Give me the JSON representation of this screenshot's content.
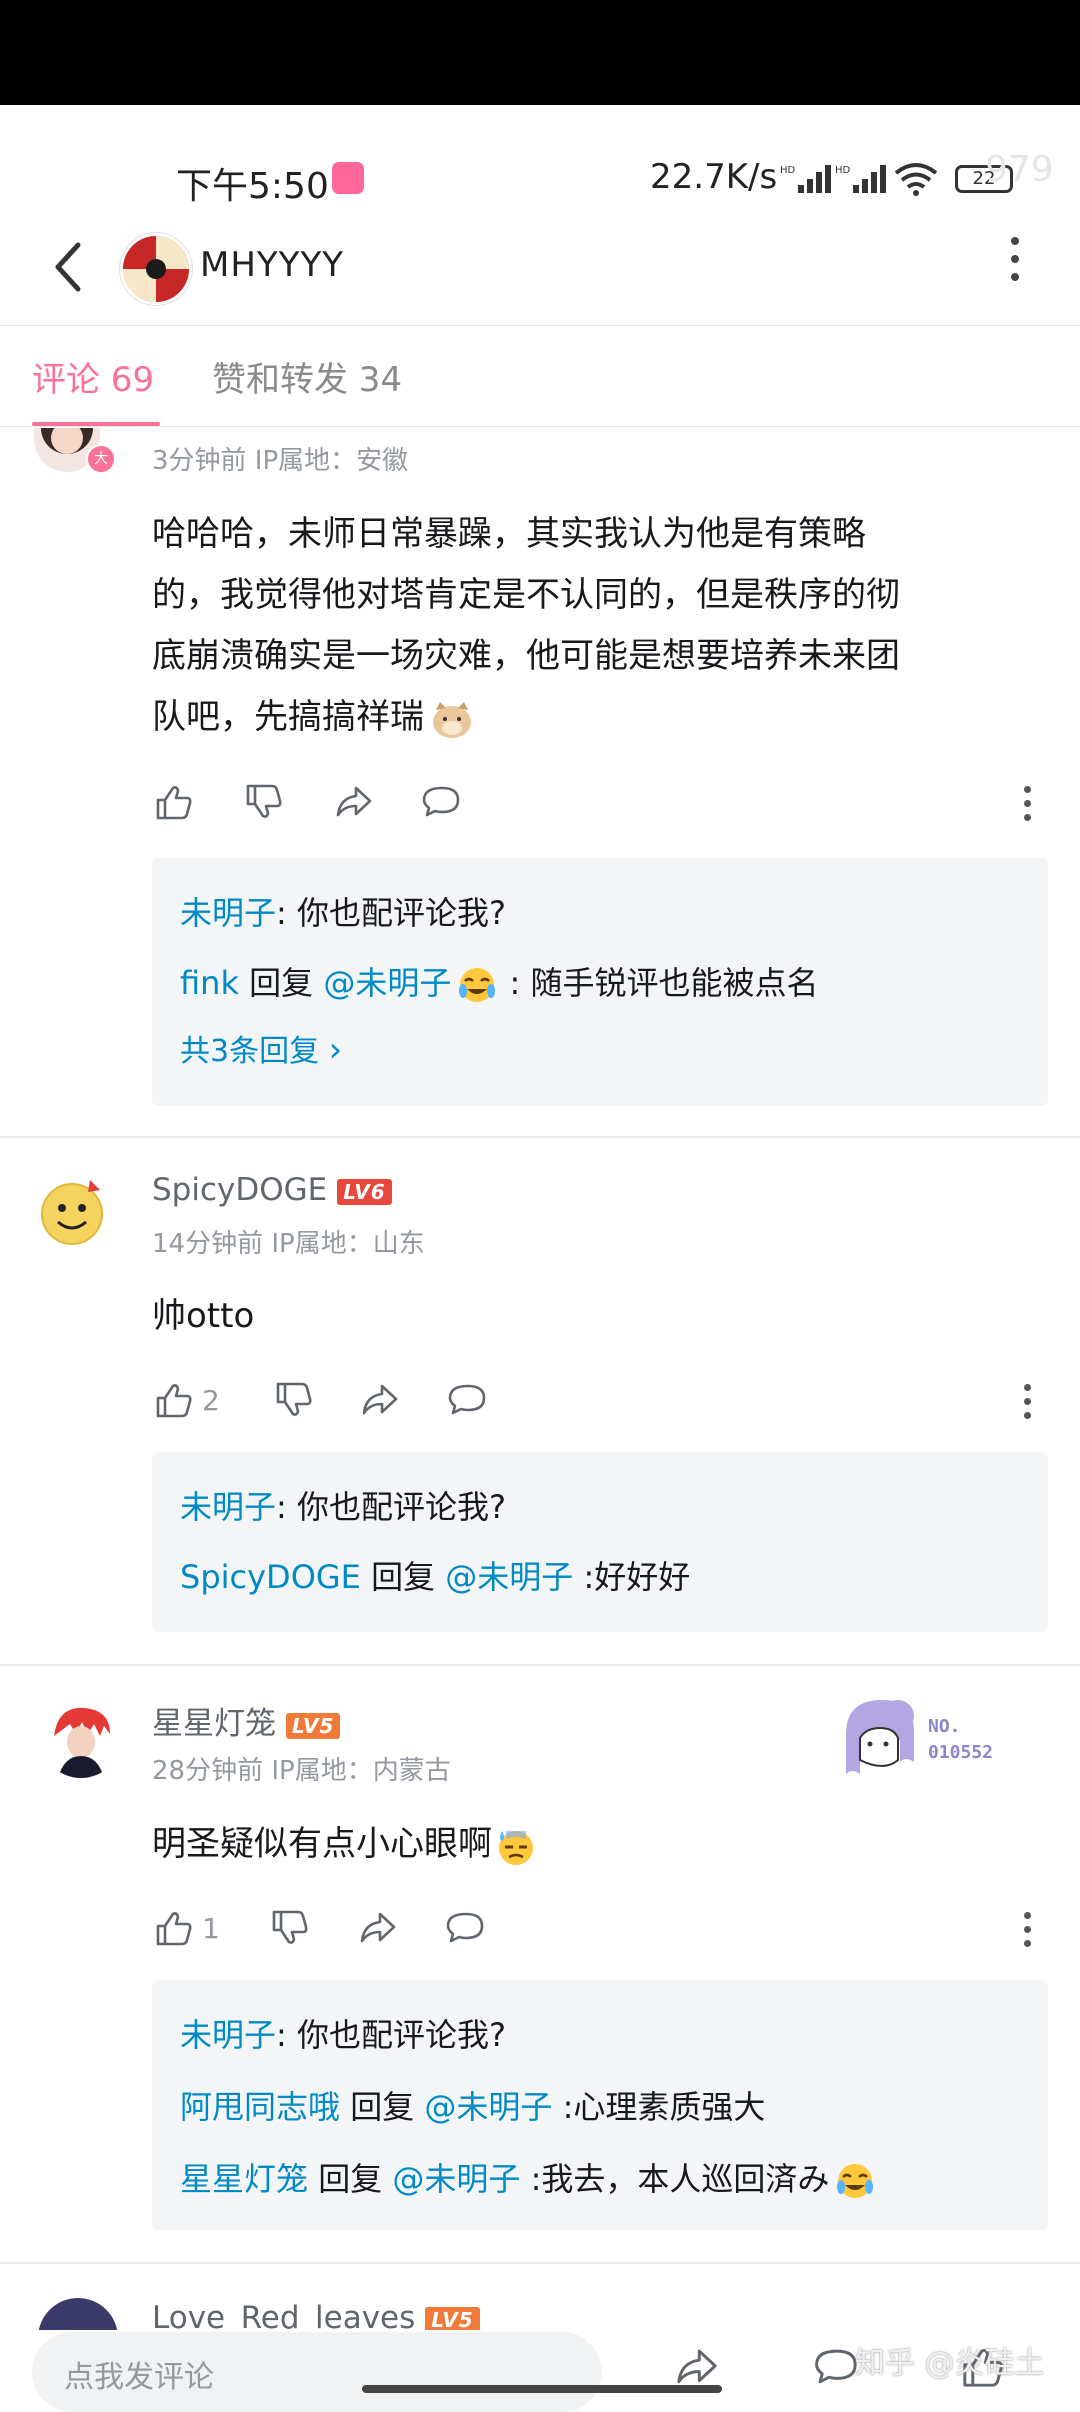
{
  "status_bar": {
    "time": "下午5:50",
    "speed": "22.7K/s",
    "battery": "22",
    "ghost": "979"
  },
  "header": {
    "name": "MHYYYY"
  },
  "tabs": [
    {
      "label": "评论 69",
      "active": true
    },
    {
      "label": "赞和转发 34",
      "active": false
    }
  ],
  "comments": [
    {
      "meta": "3分钟前  IP属地：安徽",
      "lines": [
        "哈哈哈，未师日常暴躁，其实我认为他是有策略",
        "的，我觉得他对塔肯定是不认同的，但是秩序的彻",
        "底崩溃确实是一场灾难，他可能是想要培养未来团",
        "队吧，先搞搞祥瑞"
      ],
      "replies": [
        {
          "user": "未明子",
          "text": ": 你也配评论我?"
        },
        {
          "user": "fink",
          "mid": " 回复 ",
          "at": "@未明子",
          "text": " :  随手锐评也能被点名"
        }
      ],
      "more": "共3条回复"
    },
    {
      "name": "SpicyDOGE",
      "level": "LV6",
      "meta": "14分钟前  IP属地：山东",
      "text": "帅otto",
      "likes": "2",
      "replies": [
        {
          "user": "未明子",
          "text": ": 你也配评论我?"
        },
        {
          "user": "SpicyDOGE",
          "mid": " 回复 ",
          "at": "@未明子",
          "text": " :好好好"
        }
      ]
    },
    {
      "name": "星星灯笼",
      "level": "LV5",
      "meta": "28分钟前  IP属地：内蒙古",
      "text": "明圣疑似有点小心眼啊",
      "likes": "1",
      "badge_no": "NO.",
      "badge_num": "010552",
      "replies": [
        {
          "user": "未明子",
          "text": ": 你也配评论我?"
        },
        {
          "user": "阿甩同志哦",
          "mid": " 回复 ",
          "at": "@未明子",
          "text": " :心理素质强大"
        },
        {
          "user": "星星灯笼",
          "mid": " 回复 ",
          "at": "@未明子",
          "text": " :我去，本人巡回済み"
        }
      ]
    },
    {
      "name": "Love_Red_leaves",
      "level": "LV5"
    }
  ],
  "bottom": {
    "placeholder": "点我发评论",
    "watermark": "知乎 @炎硅土"
  },
  "colors": {
    "accent": "#fb7299",
    "link": "#008ac5",
    "level_badge": "#e6493b"
  }
}
